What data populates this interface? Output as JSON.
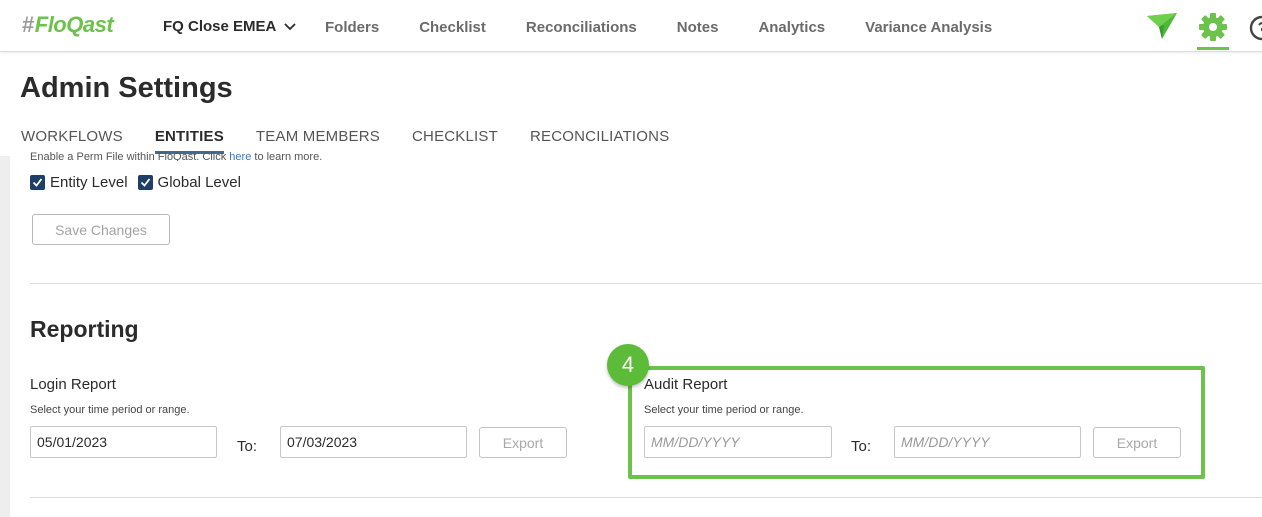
{
  "nav": {
    "logo_hash": "#",
    "logo_text": "FloQast",
    "workspace": "FQ Close EMEA",
    "links": [
      "Folders",
      "Checklist",
      "Reconciliations",
      "Notes",
      "Analytics",
      "Variance Analysis"
    ],
    "icons": [
      "paper-plane-icon",
      "gear-icon",
      "help-icon"
    ],
    "accent_color": "#6cc24a"
  },
  "page": {
    "title": "Admin Settings",
    "tabs": [
      "WORKFLOWS",
      "ENTITIES",
      "TEAM MEMBERS",
      "CHECKLIST",
      "RECONCILIATIONS"
    ],
    "active_tab": "ENTITIES"
  },
  "perm_file": {
    "desc_before": "Enable a Perm File within FloQast. Click ",
    "desc_link": "here",
    "desc_after": " to learn more.",
    "entity_level_label": "Entity Level",
    "entity_level_checked": true,
    "global_level_label": "Global Level",
    "global_level_checked": true,
    "save_label": "Save Changes"
  },
  "reporting": {
    "title": "Reporting",
    "login": {
      "title": "Login Report",
      "subtitle": "Select your time period or range.",
      "from_value": "05/01/2023",
      "to_label": "To:",
      "to_value": "07/03/2023",
      "export_label": "Export"
    },
    "audit": {
      "title": "Audit Report",
      "subtitle": "Select your time period or range.",
      "from_placeholder": "MM/DD/YYYY",
      "to_label": "To:",
      "to_placeholder": "MM/DD/YYYY",
      "export_label": "Export"
    }
  },
  "annotation": {
    "step": "4",
    "color": "#6cc24a"
  }
}
